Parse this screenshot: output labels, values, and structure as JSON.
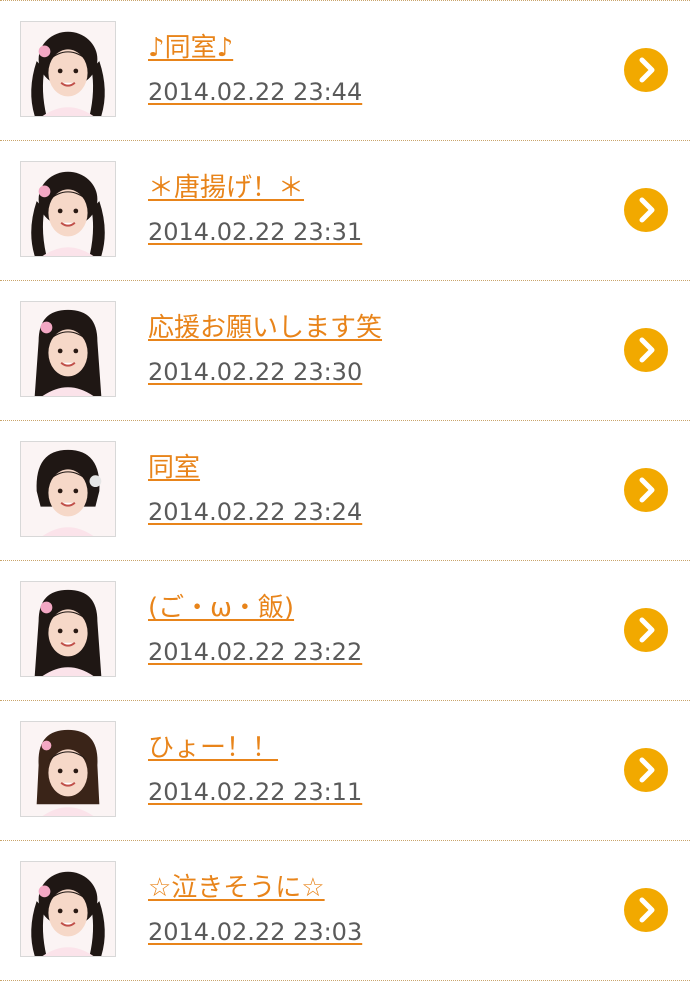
{
  "accent_color": "#e8841a",
  "arrow_color": "#f2a900",
  "posts": [
    {
      "title": "♪同室♪",
      "date": "2014.02.22 23:44",
      "avatar": "member-photo",
      "hair": "twintails"
    },
    {
      "title": "＊唐揚げ！＊",
      "date": "2014.02.22 23:31",
      "avatar": "member-photo",
      "hair": "twintails"
    },
    {
      "title": "応援お願いします笑",
      "date": "2014.02.22 23:30",
      "avatar": "member-photo",
      "hair": "long"
    },
    {
      "title": "同室",
      "date": "2014.02.22 23:24",
      "avatar": "member-photo",
      "hair": "short"
    },
    {
      "title": "(ご・ω・飯)",
      "date": "2014.02.22 23:22",
      "avatar": "member-photo",
      "hair": "long"
    },
    {
      "title": "ひょー！！",
      "date": "2014.02.22 23:11",
      "avatar": "member-photo",
      "hair": "bob"
    },
    {
      "title": "☆泣きそうに☆",
      "date": "2014.02.22 23:03",
      "avatar": "member-photo",
      "hair": "twintails"
    }
  ]
}
